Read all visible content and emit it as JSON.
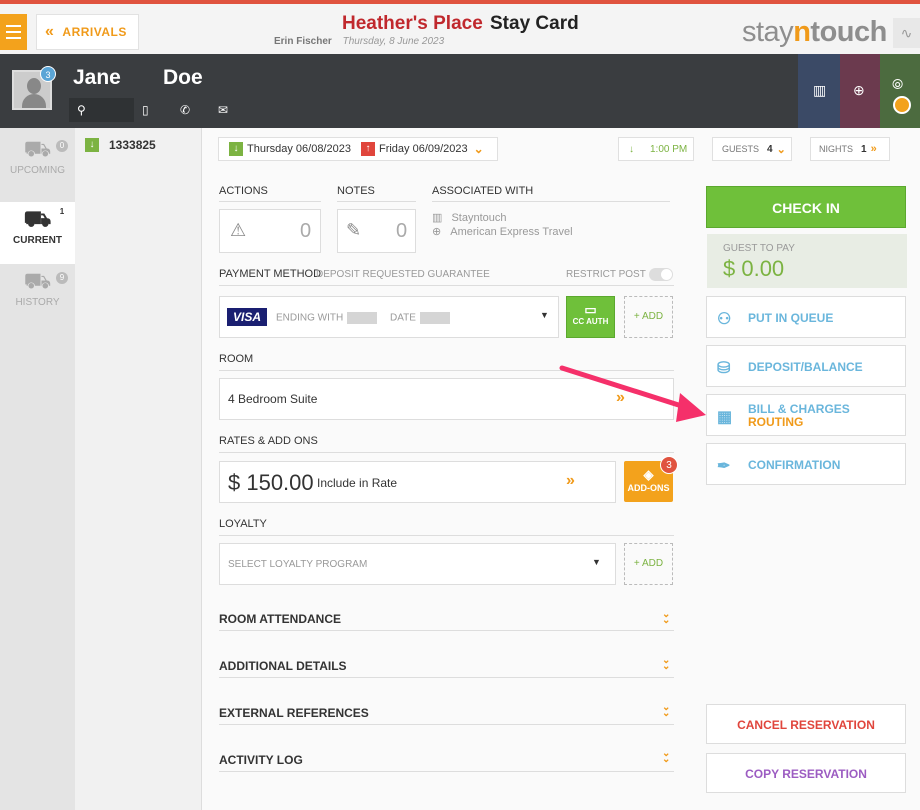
{
  "header": {
    "arrivals_label": "ARRIVALS",
    "hotel_name": "Heather's Place",
    "page_title": "Stay Card",
    "user_name": "Erin Fischer",
    "date": "Thursday, 8 June 2023",
    "logo_part1": "stay",
    "logo_part2": "n",
    "logo_part3": "touch"
  },
  "guest": {
    "first_name": "Jane",
    "last_name": "Doe",
    "avatar_badge": "3"
  },
  "nav": {
    "upcoming_label": "UPCOMING",
    "upcoming_count": "0",
    "current_label": "CURRENT",
    "current_count": "1",
    "history_label": "HISTORY",
    "history_count": "9"
  },
  "reservation": {
    "number": "1333825",
    "arrival_date": "Thursday 06/08/2023",
    "departure_date": "Friday 06/09/2023",
    "arrival_time": "1:00 PM",
    "guests_label": "GUESTS",
    "guests_count": "4",
    "nights_label": "NIGHTS",
    "nights_count": "1"
  },
  "sections": {
    "actions_label": "ACTIONS",
    "actions_count": "0",
    "notes_label": "NOTES",
    "notes_count": "0",
    "associated_label": "ASSOCIATED WITH",
    "associated_company": "Stayntouch",
    "associated_agent": "American Express Travel",
    "payment_label": "PAYMENT METHOD",
    "payment_type": "DEPOSIT REQUESTED GUARANTEE",
    "restrict_post_label": "RESTRICT POST",
    "card_brand": "VISA",
    "ending_with_label": "ENDING WITH",
    "date_label": "DATE",
    "cc_auth_label": "CC AUTH",
    "add_label": "+ ADD",
    "room_label": "ROOM",
    "room_type": "4 Bedroom Suite",
    "rates_label": "RATES & ADD ONS",
    "rate_amount": "$ 150.00",
    "rate_desc": "Include in Rate",
    "addons_label": "ADD-ONS",
    "addons_count": "3",
    "loyalty_label": "LOYALTY",
    "loyalty_placeholder": "SELECT LOYALTY PROGRAM",
    "loyalty_add": "+ ADD",
    "room_attendance": "ROOM ATTENDANCE",
    "additional_details": "ADDITIONAL DETAILS",
    "external_references": "EXTERNAL REFERENCES",
    "activity_log": "ACTIVITY LOG"
  },
  "actions": {
    "check_in": "CHECK IN",
    "guest_to_pay_label": "GUEST TO PAY",
    "guest_to_pay_amount": "$ 0.00",
    "put_in_queue": "PUT IN QUEUE",
    "deposit_balance": "DEPOSIT/BALANCE",
    "bill_charges": "BILL & CHARGES",
    "routing": "ROUTING",
    "confirmation": "CONFIRMATION",
    "cancel_reservation": "CANCEL RESERVATION",
    "copy_reservation": "COPY RESERVATION"
  },
  "colors": {
    "brand_orange": "#f09a1a",
    "check_in_green": "#6fc03a",
    "action_blue": "#6ab6dc",
    "cancel_red": "#e0453c",
    "copy_purple": "#9c5cc2",
    "annotation_pink": "#f5306a"
  }
}
